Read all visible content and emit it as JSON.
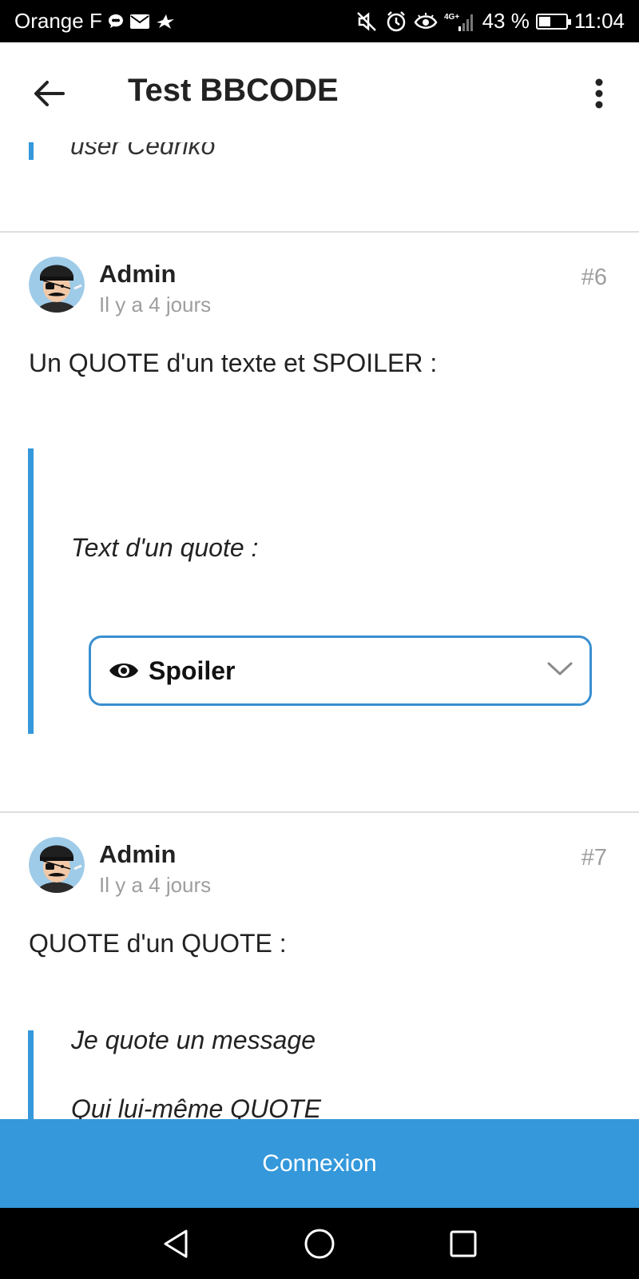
{
  "status_bar": {
    "carrier": "Orange F",
    "network": "4G+",
    "battery": "43 %",
    "battery_level": 0.43,
    "time": "11:04",
    "left_icons": [
      "chat-bubble-icon",
      "mail-icon",
      "bird-icon"
    ],
    "right_icons": [
      "mute-icon",
      "alarm-icon",
      "eye-comfort-icon",
      "signal-icon",
      "battery-icon"
    ]
  },
  "app_bar": {
    "title": "Test BBCODE",
    "back_icon": "arrow-left-icon",
    "menu_icon": "more-vertical-icon"
  },
  "previous_post": {
    "quote_fragment": "user Cedriko"
  },
  "posts": [
    {
      "author": "Admin",
      "date": "Il y a 4 jours",
      "number": "#6",
      "text": "Un QUOTE d'un texte et SPOILER :",
      "quote": {
        "text": "Text d'un quote :",
        "spoiler_label": "Spoiler"
      }
    },
    {
      "author": "Admin",
      "date": "Il y a 4 jours",
      "number": "#7",
      "text": "QUOTE d'un QUOTE :",
      "quote": {
        "text": "Je quote un message",
        "second_line_fragment": "Qui lui-même QUOTE"
      }
    }
  ],
  "login_button": "Connexion",
  "nav_bar": {
    "icons": [
      "back-triangle-icon",
      "home-circle-icon",
      "recents-square-icon"
    ]
  },
  "colors": {
    "accent": "#3498db",
    "spoiler_border": "#3a8fd0",
    "muted_text": "#9e9e9e"
  }
}
